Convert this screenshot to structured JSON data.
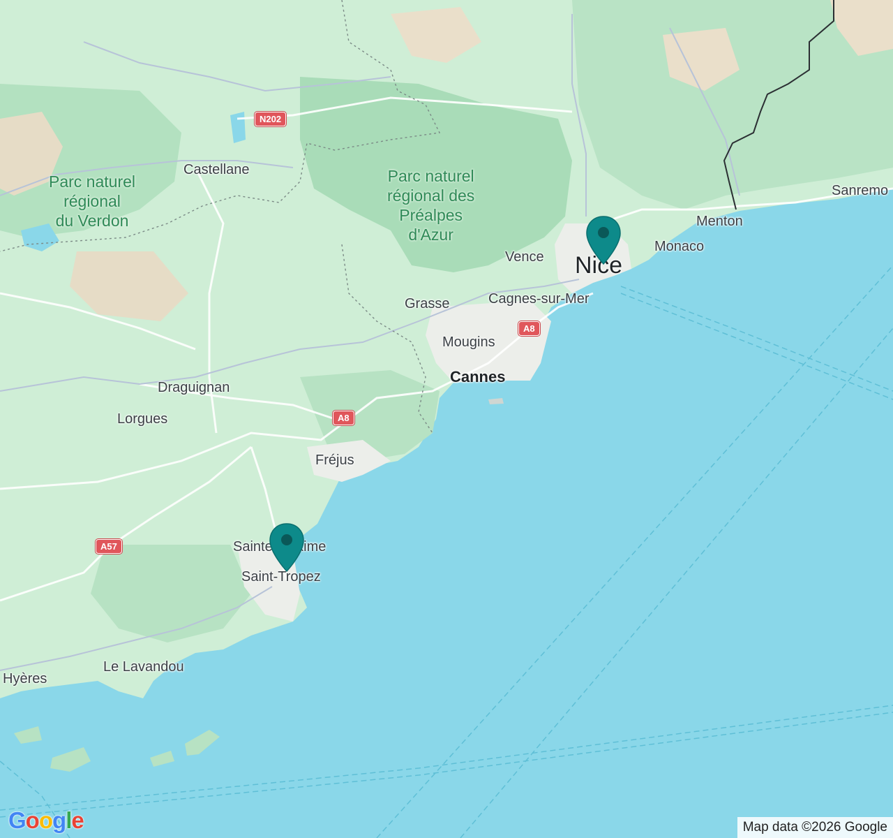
{
  "places": {
    "nice": "Nice",
    "monaco": "Monaco",
    "menton": "Menton",
    "sanremo": "Sanremo",
    "vence": "Vence",
    "cagnes": "Cagnes-sur-Mer",
    "grasse": "Grasse",
    "mougins": "Mougins",
    "cannes": "Cannes",
    "castellane": "Castellane",
    "draguignan": "Draguignan",
    "lorgues": "Lorgues",
    "frejus": "Fréjus",
    "sainte_maxime": "Sainte-Maxime",
    "saint_tropez": "Saint-Tropez",
    "le_lavandou": "Le Lavandou",
    "hyeres": "Hyères"
  },
  "parks": {
    "verdon": "Parc naturel\nrégional\ndu Verdon",
    "prealpes": "Parc naturel\nrégional des\nPréalpes\nd'Azur"
  },
  "roads": {
    "n202": "N202",
    "a8_north": "A8",
    "a8_south": "A8",
    "a57": "A57"
  },
  "markers": [
    {
      "name": "Nice",
      "color": "#0d8a8a"
    },
    {
      "name": "Saint-Tropez",
      "color": "#0d8a8a"
    }
  ],
  "logo": {
    "letters": [
      "G",
      "o",
      "o",
      "g",
      "l",
      "e"
    ],
    "colors": [
      "#4285f4",
      "#ea4335",
      "#fbbc05",
      "#4285f4",
      "#34a853",
      "#ea4335"
    ]
  },
  "attribution": "Map data ©2026 Google",
  "colors": {
    "sea": "#8ad7e9",
    "land": "#c9ead2",
    "forest": "#a6dbb6",
    "urban": "#e9eae6",
    "marker": "#0d8a8a"
  }
}
